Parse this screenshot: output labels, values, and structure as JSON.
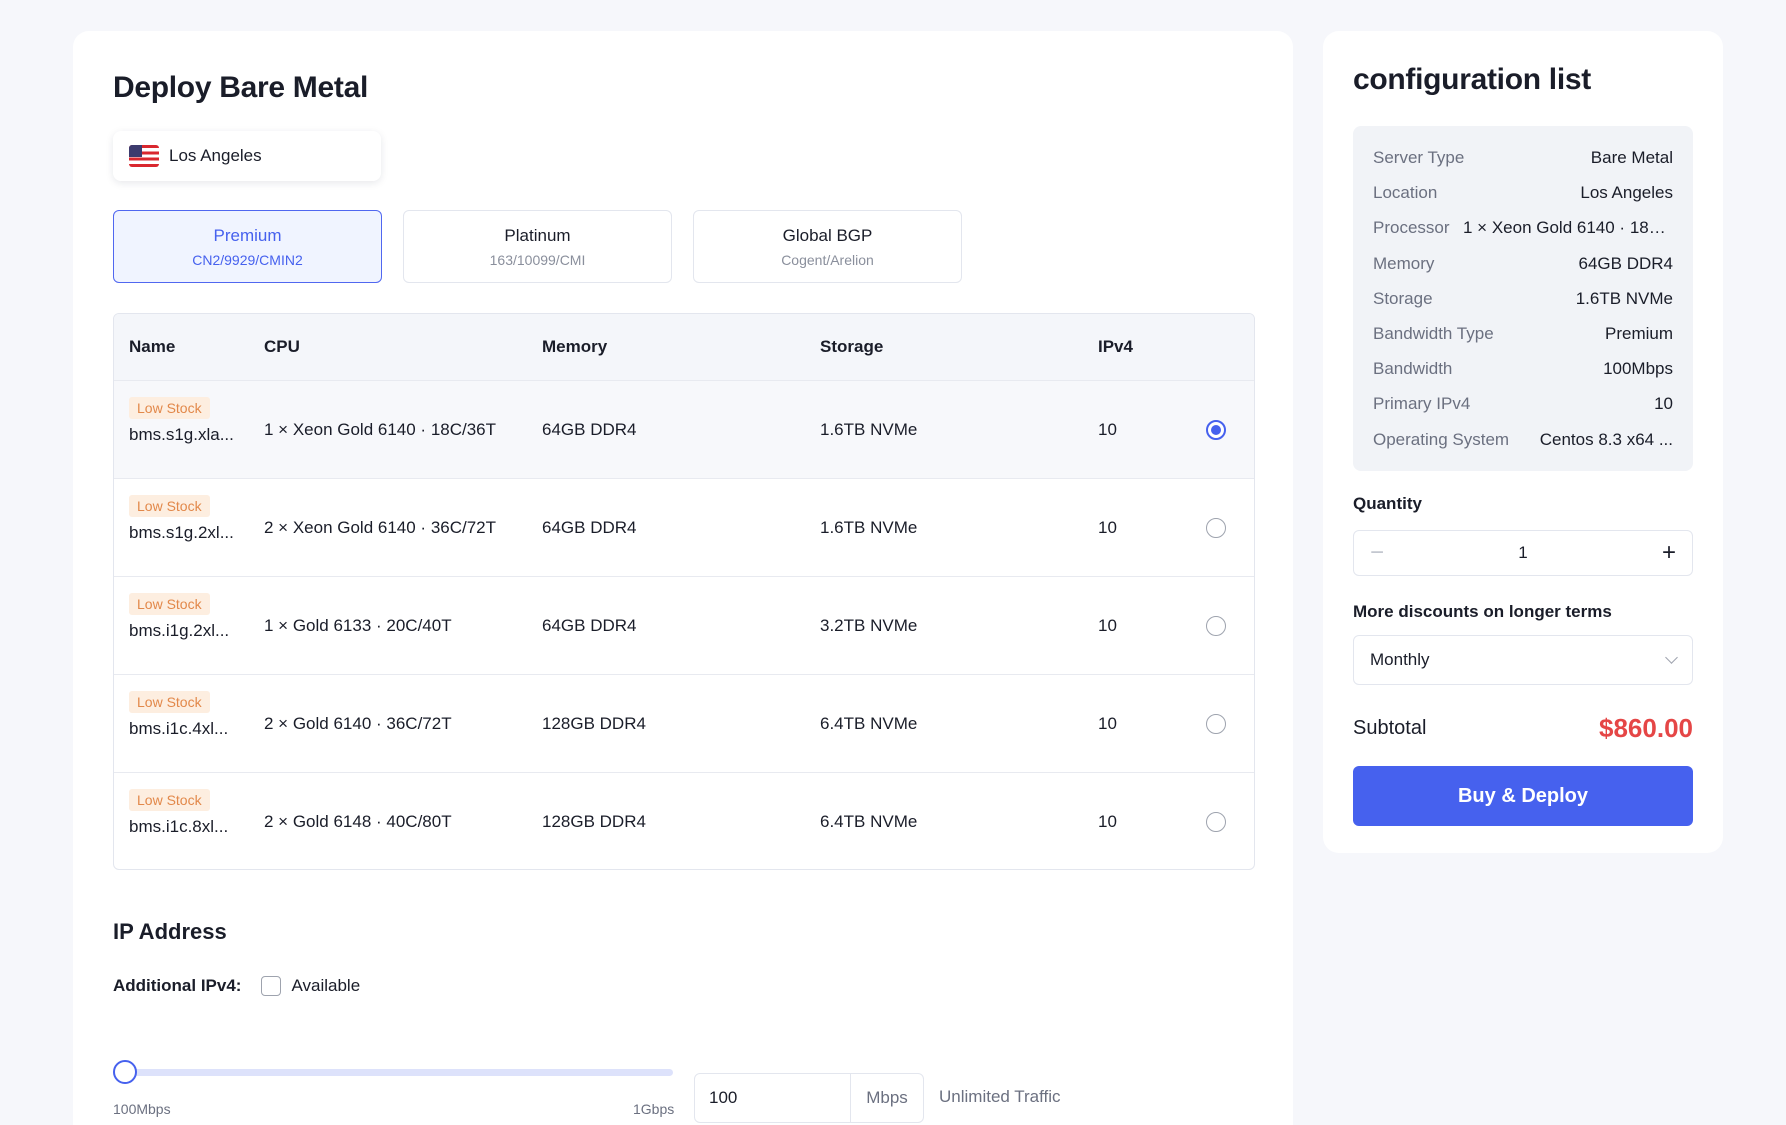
{
  "main": {
    "title": "Deploy Bare Metal",
    "location": "Los Angeles",
    "plans": [
      {
        "name": "Premium",
        "sub": "CN2/9929/CMIN2"
      },
      {
        "name": "Platinum",
        "sub": "163/10099/CMI"
      },
      {
        "name": "Global BGP",
        "sub": "Cogent/Arelion"
      }
    ],
    "table": {
      "headers": [
        "Name",
        "CPU",
        "Memory",
        "Storage",
        "IPv4"
      ],
      "rows": [
        {
          "badge": "Low Stock",
          "name": "bms.s1g.xla...",
          "cpu": "1 × Xeon Gold 6140 · 18C/36T",
          "memory": "64GB DDR4",
          "storage": "1.6TB NVMe",
          "ipv4": "10"
        },
        {
          "badge": "Low Stock",
          "name": "bms.s1g.2xl...",
          "cpu": "2 × Xeon Gold 6140 · 36C/72T",
          "memory": "64GB DDR4",
          "storage": "1.6TB NVMe",
          "ipv4": "10"
        },
        {
          "badge": "Low Stock",
          "name": "bms.i1g.2xl...",
          "cpu": "1 × Gold 6133 · 20C/40T",
          "memory": "64GB DDR4",
          "storage": "3.2TB NVMe",
          "ipv4": "10"
        },
        {
          "badge": "Low Stock",
          "name": "bms.i1c.4xl...",
          "cpu": "2 × Gold 6140 · 36C/72T",
          "memory": "128GB DDR4",
          "storage": "6.4TB NVMe",
          "ipv4": "10"
        },
        {
          "badge": "Low Stock",
          "name": "bms.i1c.8xl...",
          "cpu": "2 × Gold 6148 · 40C/80T",
          "memory": "128GB DDR4",
          "storage": "6.4TB NVMe",
          "ipv4": "10"
        }
      ]
    },
    "ip": {
      "title": "IP Address",
      "additional_label": "Additional IPv4:",
      "checkbox_label": "Available"
    },
    "bandwidth": {
      "min_label": "100Mbps",
      "max_label": "1Gbps",
      "value": "100",
      "unit": "Mbps",
      "note": "Unlimited Traffic",
      "slider_level": 0
    }
  },
  "side": {
    "title": "configuration list",
    "config": [
      {
        "k": "Server Type",
        "v": "Bare Metal"
      },
      {
        "k": "Location",
        "v": "Los Angeles"
      },
      {
        "k": "Processor",
        "v": "1 × Xeon Gold 6140 · 18C/..."
      },
      {
        "k": "Memory",
        "v": "64GB DDR4"
      },
      {
        "k": "Storage",
        "v": "1.6TB NVMe"
      },
      {
        "k": "Bandwidth Type",
        "v": "Premium"
      },
      {
        "k": "Bandwidth",
        "v": "100Mbps"
      },
      {
        "k": "Primary IPv4",
        "v": "10"
      },
      {
        "k": "Operating System",
        "v": "Centos 8.3 x64 ..."
      }
    ],
    "quantity_label": "Quantity",
    "quantity": "1",
    "minus": "−",
    "plus": "+",
    "term_label": "More discounts on longer terms",
    "term_value": "Monthly",
    "subtotal_label": "Subtotal",
    "subtotal_value": "$860.00",
    "buy_label": "Buy & Deploy"
  },
  "colors": {
    "accent": "#4661ee",
    "price": "#e54646",
    "badge_bg": "#fdeee0",
    "badge_text": "#e2884a"
  },
  "icons": [
    "us-flag-icon",
    "radio-selected-icon",
    "radio-empty-icon",
    "checkbox-icon",
    "minus-icon",
    "plus-icon",
    "chevron-down-icon",
    "slider-thumb"
  ]
}
